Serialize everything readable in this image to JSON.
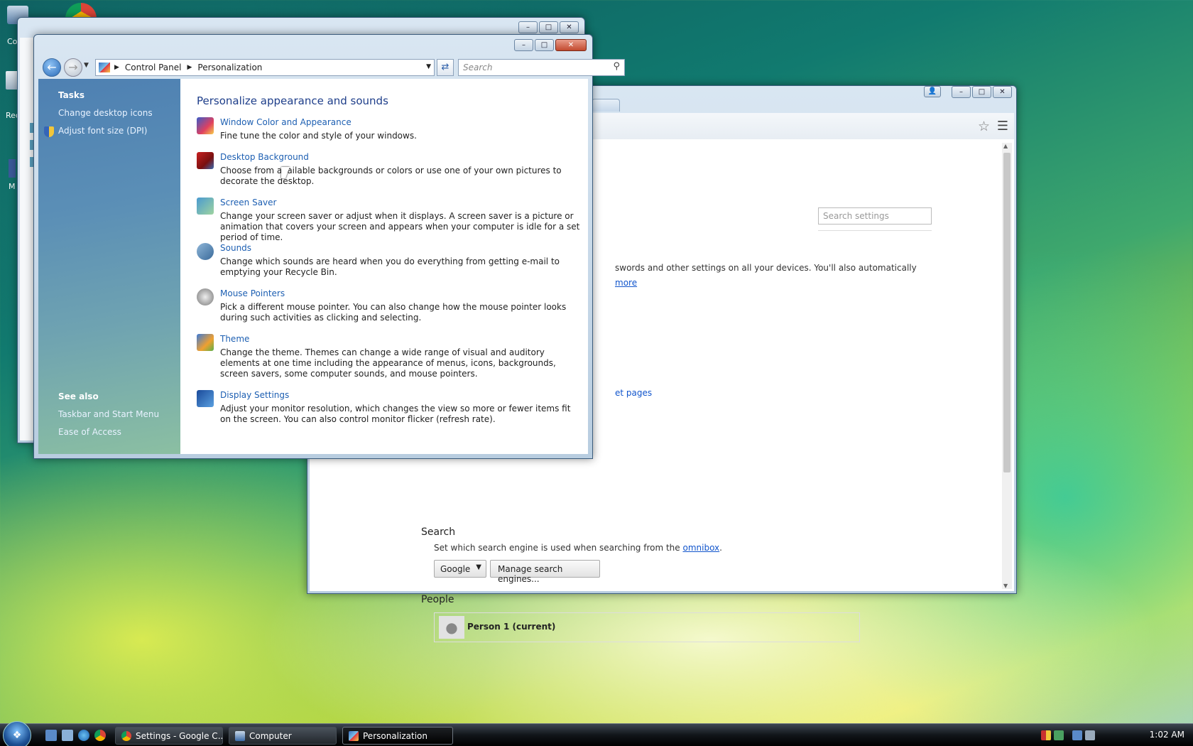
{
  "desktop": {
    "icon_labels": [
      "Co",
      "Rec",
      "M"
    ]
  },
  "computer_window": {
    "title": "Computer"
  },
  "chrome": {
    "search_placeholder": "Search settings",
    "sync_text": "swords and other settings on all your devices. You'll also automatically",
    "learn_more": "more",
    "startup_pages_link": "et pages",
    "search_heading": "Search",
    "search_desc_prefix": "Set which search engine is used when searching from the ",
    "search_desc_link": "omnibox",
    "search_desc_suffix": ".",
    "engine_selected": "Google",
    "manage_engines": "Manage search engines...",
    "people_heading": "People",
    "person_name": "Person 1 (current)"
  },
  "control_panel": {
    "breadcrumb": [
      "Control Panel",
      "Personalization"
    ],
    "search_placeholder": "Search",
    "tasks_heading": "Tasks",
    "tasks": [
      "Change desktop icons",
      "Adjust font size (DPI)"
    ],
    "see_also_heading": "See also",
    "see_also": [
      "Taskbar and Start Menu",
      "Ease of Access"
    ],
    "page_title": "Personalize appearance and sounds",
    "items": [
      {
        "title": "Window Color and Appearance",
        "desc": "Fine tune the color and style of your windows.",
        "icon": "window-color-icon"
      },
      {
        "title": "Desktop Background",
        "desc": "Choose from available backgrounds or colors or use one of your own pictures to decorate the desktop.",
        "icon": "desktop-background-icon"
      },
      {
        "title": "Screen Saver",
        "desc": "Change your screen saver or adjust when it displays. A screen saver is a picture or animation that covers your screen and appears when your computer is idle for a set period of time.",
        "icon": "screen-saver-icon"
      },
      {
        "title": "Sounds",
        "desc": "Change which sounds are heard when you do everything from getting e-mail to emptying your Recycle Bin.",
        "icon": "sounds-icon"
      },
      {
        "title": "Mouse Pointers",
        "desc": "Pick a different mouse pointer. You can also change how the mouse pointer looks during such activities as clicking and selecting.",
        "icon": "mouse-pointers-icon"
      },
      {
        "title": "Theme",
        "desc": "Change the theme. Themes can change a wide range of visual and auditory elements at one time including the appearance of menus, icons, backgrounds, screen savers, some computer sounds, and mouse pointers.",
        "icon": "theme-icon"
      },
      {
        "title": "Display Settings",
        "desc": "Adjust your monitor resolution, which changes the view so more or fewer items fit on the screen. You can also control monitor flicker (refresh rate).",
        "icon": "display-settings-icon"
      }
    ]
  },
  "taskbar": {
    "buttons": [
      {
        "label": "Settings - Google C...",
        "icon": "chrome-icon"
      },
      {
        "label": "Computer",
        "icon": "computer-icon"
      },
      {
        "label": "Personalization",
        "icon": "control-panel-icon",
        "active": true
      }
    ],
    "clock": "1:02 AM"
  }
}
